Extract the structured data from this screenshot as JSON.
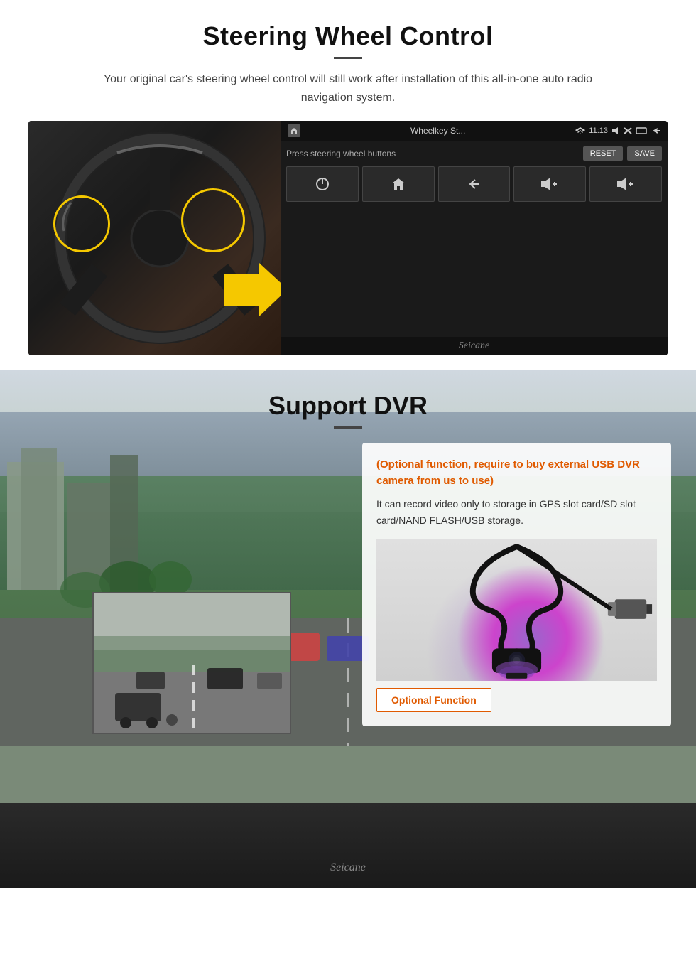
{
  "swc_section": {
    "title": "Steering Wheel Control",
    "description": "Your original car's steering wheel control will still work after installation of this all-in-one auto radio navigation system.",
    "android_screen": {
      "app_title": "Wheelkey St...",
      "icons_row": "🔊 ψ",
      "time": "11:13",
      "instruction": "Press steering wheel buttons",
      "reset_btn": "RESET",
      "save_btn": "SAVE",
      "buttons": [
        "⏻",
        "🏠",
        "↩",
        "🔊+",
        "🔊+"
      ]
    },
    "watermark": "Seicane"
  },
  "dvr_section": {
    "title": "Support DVR",
    "card": {
      "title_text": "(Optional function, require to buy external USB DVR camera from us to use)",
      "body_text": "It can record video only to storage in GPS slot card/SD slot card/NAND FLASH/USB storage.",
      "optional_badge": "Optional Function"
    },
    "watermark": "Seicane"
  }
}
